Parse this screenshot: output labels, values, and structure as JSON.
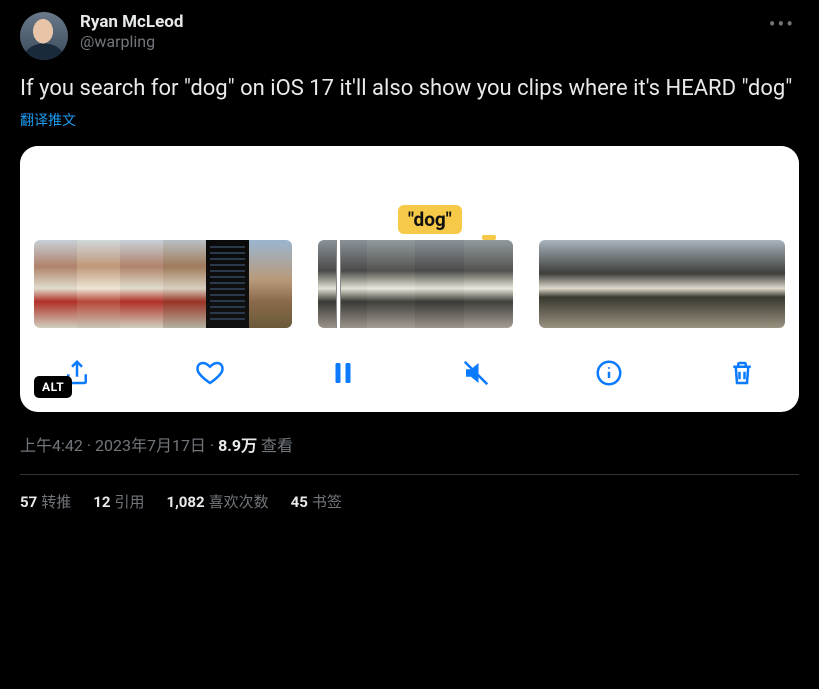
{
  "author": {
    "display_name": "Ryan McLeod",
    "handle": "@warpling"
  },
  "tweet_text": "If you search for \"dog\" on iOS 17 it'll also show you clips where it's HEARD \"dog\"",
  "translate_label": "翻译推文",
  "media": {
    "search_badge": "\"dog\"",
    "alt_badge": "ALT"
  },
  "timestamp": {
    "time": "上午4:42",
    "date": "2023年7月17日",
    "views_number": "8.9万",
    "views_label": "查看"
  },
  "stats": {
    "retweets": {
      "count": "57",
      "label": "转推"
    },
    "quotes": {
      "count": "12",
      "label": "引用"
    },
    "likes": {
      "count": "1,082",
      "label": "喜欢次数"
    },
    "bookmarks": {
      "count": "45",
      "label": "书签"
    }
  }
}
